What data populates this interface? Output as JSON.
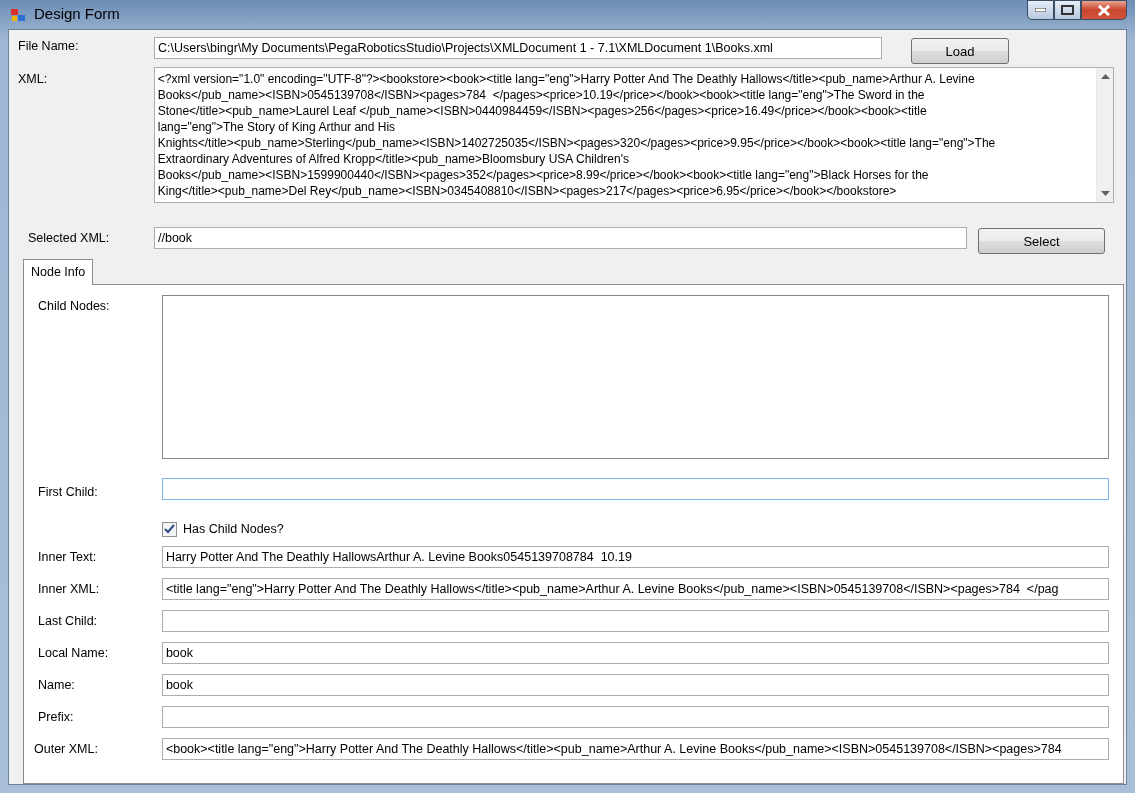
{
  "window": {
    "title": "Design Form"
  },
  "file_name": {
    "label": "File Name:",
    "value": "C:\\Users\\bingr\\My Documents\\PegaRoboticsStudio\\Projects\\XMLDocument 1 - 7.1\\XMLDocument 1\\Books.xml",
    "button": "Load"
  },
  "xml": {
    "label": "XML:",
    "lines": [
      "<?xml version=\"1.0\" encoding=\"UTF-8\"?><bookstore><book><title lang=\"eng\">Harry Potter And The Deathly Hallows</title><pub_name>Arthur A. Levine",
      "Books</pub_name><ISBN>0545139708</ISBN><pages>784  </pages><price>10.19</price></book><book><title lang=\"eng\">The Sword in the",
      "Stone</title><pub_name>Laurel Leaf </pub_name><ISBN>0440984459</ISBN><pages>256</pages><price>16.49</price></book><book><title",
      "lang=\"eng\">The Story of King Arthur and His",
      "Knights</title><pub_name>Sterling</pub_name><ISBN>1402725035</ISBN><pages>320</pages><price>9.95</price></book><book><title lang=\"eng\">The",
      "Extraordinary Adventures of Alfred Kropp</title><pub_name>Bloomsbury USA Children's",
      "Books</pub_name><ISBN>1599900440</ISBN><pages>352</pages><price>8.99</price></book><book><title lang=\"eng\">Black Horses for the",
      "King</title><pub_name>Del Rey</pub_name><ISBN>0345408810</ISBN><pages>217</pages><price>6.95</price></book></bookstore>"
    ]
  },
  "selected_xml": {
    "label": "Selected XML:",
    "value": "//book",
    "button": "Select"
  },
  "tabs": [
    {
      "label": "Node Info",
      "selected": true
    }
  ],
  "node_info": {
    "child_nodes": {
      "label": "Child Nodes:"
    },
    "first_child": {
      "label": "First Child:"
    },
    "has_child_nodes": {
      "label": "Has Child Nodes?",
      "checked": true
    },
    "fields": [
      {
        "label": "Inner Text:",
        "value": "Harry Potter And The Deathly HallowsArthur A. Levine Books0545139708784  10.19"
      },
      {
        "label": "Inner XML:",
        "value": "<title lang=\"eng\">Harry Potter And The Deathly Hallows</title><pub_name>Arthur A. Levine Books</pub_name><ISBN>0545139708</ISBN><pages>784  </pag"
      },
      {
        "label": "Last Child:"
      },
      {
        "label": "Local Name:",
        "value": "book"
      },
      {
        "label": "Name:",
        "value": "book"
      },
      {
        "label": "Prefix:"
      },
      {
        "label": "Outer XML:",
        "value": "<book><title lang=\"eng\">Harry Potter And The Deathly Hallows</title><pub_name>Arthur A. Levine Books</pub_name><ISBN>0545139708</ISBN><pages>784"
      }
    ]
  }
}
